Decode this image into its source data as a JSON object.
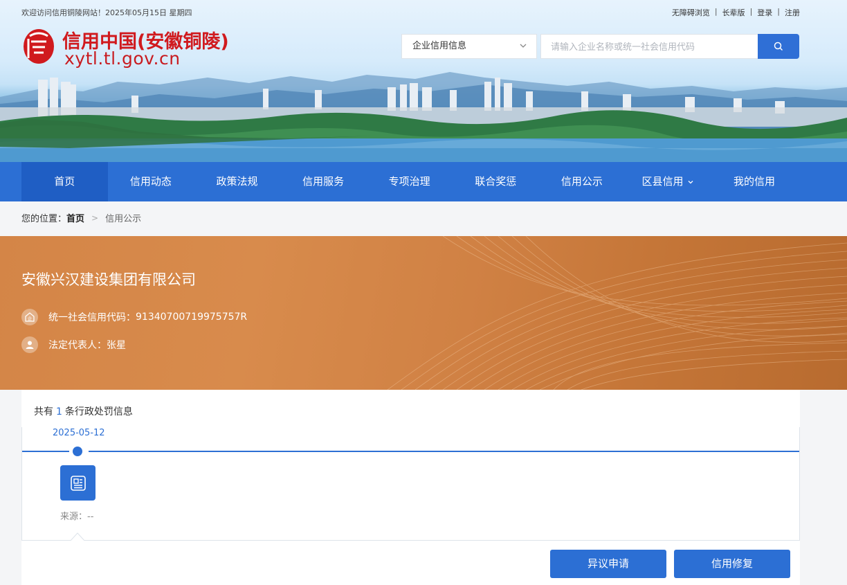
{
  "header": {
    "welcome": "欢迎访问信用铜陵网站！2025年05月15日 星期四",
    "links": [
      "无障碍浏览",
      "长辈版",
      "登录",
      "注册"
    ],
    "logo_title": "信用中国(安徽铜陵)",
    "logo_url": "xytl.tl.gov.cn",
    "logo_mark_char": "信"
  },
  "search": {
    "category": "企业信用信息",
    "placeholder": "请输入企业名称或统一社会信用代码"
  },
  "nav": {
    "items": [
      "首页",
      "信用动态",
      "政策法规",
      "信用服务",
      "专项治理",
      "联合奖惩",
      "信用公示",
      "区县信用",
      "我的信用"
    ],
    "active_index": 0
  },
  "breadcrumb": {
    "prefix": "您的位置：",
    "home": "首页",
    "current": "信用公示"
  },
  "company": {
    "name": "安徽兴汉建设集团有限公司",
    "code_label": "统一社会信用代码：",
    "code": "91340700719975757R",
    "rep_label": "法定代表人：",
    "rep": "张星"
  },
  "records": {
    "count_prefix": "共有",
    "count": "1",
    "count_suffix": "条行政处罚信息",
    "items": [
      {
        "date": "2025-05-12",
        "source_label": "来源：",
        "source": "--"
      }
    ]
  },
  "actions": {
    "objection": "异议申请",
    "repair": "信用修复"
  },
  "colors": {
    "primary": "#2c6fd4",
    "brand_red": "#d01a1e",
    "hero_orange": "#d48547"
  }
}
